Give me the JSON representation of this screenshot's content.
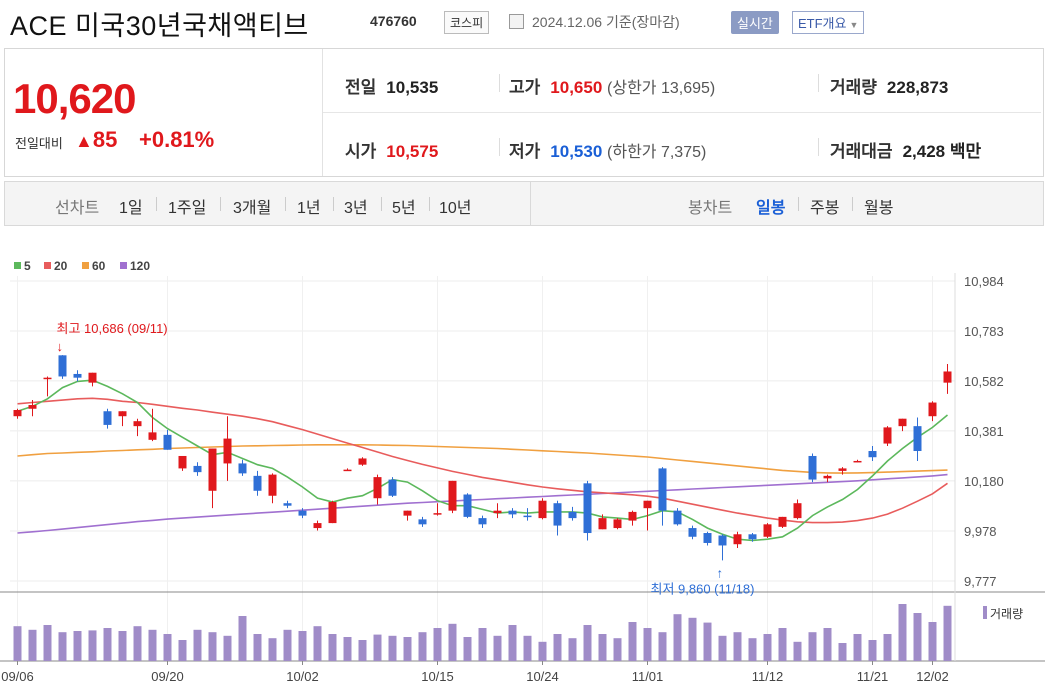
{
  "header": {
    "name": "ACE 미국30년국채액티브",
    "code": "476760",
    "market": "코스피",
    "date": "2024.12.06 기준(장마감)",
    "realtime": "실시간",
    "etf": "ETF개요"
  },
  "price": {
    "current": "10,620",
    "compare_label": "전일대비",
    "change": "85",
    "change_pct": "+0.81%",
    "prev_label": "전일",
    "prev": "10,535",
    "open_label": "시가",
    "open": "10,575",
    "high_label": "고가",
    "high": "10,650",
    "upper_limit_text": "(상한가 13,695)",
    "low_label": "저가",
    "low": "10,530",
    "lower_limit_text": "(하한가 7,375)",
    "volume_label": "거래량",
    "volume": "228,873",
    "amount_label": "거래대금",
    "amount": "2,428",
    "amount_unit": "백만"
  },
  "period_bar": {
    "line_chart": "선차트",
    "periods": [
      "1일",
      "1주일",
      "3개월",
      "1년",
      "3년",
      "5년",
      "10년"
    ],
    "candle_chart": "봉차트",
    "candle_periods": [
      "일봉",
      "주봉",
      "월봉"
    ],
    "selected_candle": "일봉"
  },
  "colors": {
    "up": "#e0181c",
    "down": "#2f6fd6",
    "ma5": "#5cb85c",
    "ma20": "#e85c5c",
    "ma60": "#f0a040",
    "ma120": "#a070d0",
    "volume": "#a08cc8"
  },
  "chart_data": {
    "type": "candlestick",
    "legend": [
      "5",
      "20",
      "60",
      "120"
    ],
    "y_ticks": [
      "10,984",
      "10,783",
      "10,582",
      "10,381",
      "10,180",
      "9,978",
      "9,777"
    ],
    "ylim": [
      9777,
      10984
    ],
    "x_labels": [
      "09/06",
      "09/20",
      "10/02",
      "10/15",
      "10/24",
      "11/01",
      "11/12",
      "11/21",
      "12/02"
    ],
    "annotation_high": "최고 10,686 (09/11)",
    "annotation_low": "최저 9,860 (11/18)",
    "volume_label": "거래량",
    "candles": [
      {
        "o": 10440,
        "h": 10470,
        "l": 10430,
        "c": 10465
      },
      {
        "o": 10470,
        "h": 10505,
        "l": 10440,
        "c": 10485
      },
      {
        "o": 10590,
        "h": 10600,
        "l": 10520,
        "c": 10595
      },
      {
        "o": 10685,
        "h": 10686,
        "l": 10590,
        "c": 10600
      },
      {
        "o": 10610,
        "h": 10625,
        "l": 10580,
        "c": 10595
      },
      {
        "o": 10575,
        "h": 10615,
        "l": 10560,
        "c": 10615
      },
      {
        "o": 10460,
        "h": 10470,
        "l": 10390,
        "c": 10405
      },
      {
        "o": 10440,
        "h": 10460,
        "l": 10400,
        "c": 10460
      },
      {
        "o": 10400,
        "h": 10430,
        "l": 10360,
        "c": 10420
      },
      {
        "o": 10345,
        "h": 10470,
        "l": 10340,
        "c": 10375
      },
      {
        "o": 10365,
        "h": 10385,
        "l": 10305,
        "c": 10305
      },
      {
        "o": 10230,
        "h": 10250,
        "l": 10220,
        "c": 10280
      },
      {
        "o": 10240,
        "h": 10255,
        "l": 10200,
        "c": 10215
      },
      {
        "o": 10140,
        "h": 10310,
        "l": 10070,
        "c": 10310
      },
      {
        "o": 10250,
        "h": 10440,
        "l": 10180,
        "c": 10350
      },
      {
        "o": 10250,
        "h": 10265,
        "l": 10200,
        "c": 10210
      },
      {
        "o": 10200,
        "h": 10220,
        "l": 10120,
        "c": 10140
      },
      {
        "o": 10120,
        "h": 10210,
        "l": 10090,
        "c": 10205
      },
      {
        "o": 10090,
        "h": 10100,
        "l": 10070,
        "c": 10080
      },
      {
        "o": 10060,
        "h": 10070,
        "l": 10030,
        "c": 10040
      },
      {
        "o": 9990,
        "h": 10020,
        "l": 9980,
        "c": 10010
      },
      {
        "o": 10010,
        "h": 10100,
        "l": 10010,
        "c": 10095
      },
      {
        "o": 10225,
        "h": 10230,
        "l": 10220,
        "c": 10225
      },
      {
        "o": 10245,
        "h": 10275,
        "l": 10240,
        "c": 10270
      },
      {
        "o": 10110,
        "h": 10205,
        "l": 10085,
        "c": 10195
      },
      {
        "o": 10185,
        "h": 10195,
        "l": 10115,
        "c": 10120
      },
      {
        "o": 10040,
        "h": 10060,
        "l": 10020,
        "c": 10060
      },
      {
        "o": 10025,
        "h": 10035,
        "l": 9995,
        "c": 10005
      },
      {
        "o": 10045,
        "h": 10090,
        "l": 10040,
        "c": 10050
      },
      {
        "o": 10060,
        "h": 10180,
        "l": 10050,
        "c": 10180
      },
      {
        "o": 10125,
        "h": 10130,
        "l": 10030,
        "c": 10035
      },
      {
        "o": 10030,
        "h": 10040,
        "l": 9990,
        "c": 10005
      },
      {
        "o": 10050,
        "h": 10090,
        "l": 10030,
        "c": 10060
      },
      {
        "o": 10060,
        "h": 10070,
        "l": 10030,
        "c": 10045
      },
      {
        "o": 10040,
        "h": 10070,
        "l": 10020,
        "c": 10035
      },
      {
        "o": 10030,
        "h": 10110,
        "l": 10025,
        "c": 10100
      },
      {
        "o": 10090,
        "h": 10100,
        "l": 9960,
        "c": 10000
      },
      {
        "o": 10055,
        "h": 10075,
        "l": 10020,
        "c": 10030
      },
      {
        "o": 10170,
        "h": 10180,
        "l": 9940,
        "c": 9970
      },
      {
        "o": 9985,
        "h": 10045,
        "l": 9985,
        "c": 10030
      },
      {
        "o": 9990,
        "h": 10030,
        "l": 9985,
        "c": 10025
      },
      {
        "o": 10020,
        "h": 10060,
        "l": 10000,
        "c": 10055
      },
      {
        "o": 10070,
        "h": 10100,
        "l": 9980,
        "c": 10100
      },
      {
        "o": 10230,
        "h": 10235,
        "l": 10000,
        "c": 10060
      },
      {
        "o": 10060,
        "h": 10070,
        "l": 10000,
        "c": 10005
      },
      {
        "o": 9990,
        "h": 10000,
        "l": 9945,
        "c": 9955
      },
      {
        "o": 9970,
        "h": 9975,
        "l": 9920,
        "c": 9930
      },
      {
        "o": 9960,
        "h": 9965,
        "l": 9860,
        "c": 9920
      },
      {
        "o": 9925,
        "h": 9975,
        "l": 9910,
        "c": 9965
      },
      {
        "o": 9965,
        "h": 9970,
        "l": 9935,
        "c": 9945
      },
      {
        "o": 9955,
        "h": 10010,
        "l": 9950,
        "c": 10005
      },
      {
        "o": 9995,
        "h": 10035,
        "l": 9990,
        "c": 10035
      },
      {
        "o": 10030,
        "h": 10105,
        "l": 10025,
        "c": 10090
      },
      {
        "o": 10280,
        "h": 10290,
        "l": 10175,
        "c": 10185
      },
      {
        "o": 10190,
        "h": 10205,
        "l": 10175,
        "c": 10200
      },
      {
        "o": 10220,
        "h": 10235,
        "l": 10205,
        "c": 10230
      },
      {
        "o": 10260,
        "h": 10265,
        "l": 10255,
        "c": 10260
      },
      {
        "o": 10300,
        "h": 10320,
        "l": 10260,
        "c": 10275
      },
      {
        "o": 10330,
        "h": 10400,
        "l": 10320,
        "c": 10395
      },
      {
        "o": 10400,
        "h": 10430,
        "l": 10380,
        "c": 10430
      },
      {
        "o": 10400,
        "h": 10435,
        "l": 10260,
        "c": 10300
      },
      {
        "o": 10440,
        "h": 10500,
        "l": 10420,
        "c": 10495
      },
      {
        "o": 10575,
        "h": 10650,
        "l": 10530,
        "c": 10620
      }
    ],
    "ma5": [
      10460,
      10480,
      10510,
      10555,
      10580,
      10585,
      10560,
      10530,
      10495,
      10435,
      10390,
      10355,
      10320,
      10285,
      10295,
      10270,
      10245,
      10230,
      10195,
      10155,
      10110,
      10095,
      10110,
      10120,
      10150,
      10185,
      10175,
      10140,
      10100,
      10080,
      10080,
      10065,
      10050,
      10055,
      10050,
      10055,
      10055,
      10055,
      10050,
      10035,
      10030,
      10025,
      10040,
      10060,
      10055,
      10025,
      9990,
      9965,
      9945,
      9940,
      9945,
      9955,
      9990,
      10040,
      10075,
      10105,
      10145,
      10200,
      10260,
      10310,
      10355,
      10395,
      10445
    ],
    "ma20": [
      10490,
      10495,
      10500,
      10505,
      10510,
      10512,
      10508,
      10500,
      10495,
      10488,
      10480,
      10472,
      10465,
      10456,
      10448,
      10440,
      10430,
      10418,
      10402,
      10386,
      10368,
      10350,
      10332,
      10314,
      10296,
      10278,
      10262,
      10246,
      10232,
      10218,
      10206,
      10194,
      10184,
      10174,
      10164,
      10155,
      10148,
      10142,
      10136,
      10132,
      10128,
      10124,
      10118,
      10110,
      10098,
      10086,
      10074,
      10062,
      10050,
      10040,
      10030,
      10022,
      10015,
      10012,
      10012,
      10014,
      10020,
      10030,
      10046,
      10070,
      10098,
      10128,
      10170
    ],
    "ma60": [
      10280,
      10285,
      10290,
      10292,
      10295,
      10297,
      10300,
      10302,
      10305,
      10307,
      10310,
      10312,
      10314,
      10316,
      10318,
      10320,
      10321,
      10322,
      10323,
      10324,
      10325,
      10325,
      10325,
      10325,
      10324,
      10323,
      10322,
      10320,
      10318,
      10316,
      10314,
      10312,
      10310,
      10307,
      10304,
      10301,
      10298,
      10295,
      10292,
      10288,
      10284,
      10280,
      10276,
      10270,
      10264,
      10258,
      10252,
      10246,
      10240,
      10234,
      10228,
      10222,
      10218,
      10214,
      10212,
      10211,
      10212,
      10213,
      10215,
      10217,
      10219,
      10221,
      10223
    ],
    "ma120": [
      9970,
      9975,
      9980,
      9986,
      9992,
      9998,
      10004,
      10010,
      10016,
      10021,
      10026,
      10030,
      10034,
      10038,
      10042,
      10046,
      10050,
      10054,
      10058,
      10062,
      10066,
      10070,
      10074,
      10078,
      10082,
      10086,
      10090,
      10093,
      10096,
      10099,
      10102,
      10105,
      10108,
      10111,
      10114,
      10117,
      10120,
      10123,
      10126,
      10129,
      10132,
      10135,
      10138,
      10141,
      10144,
      10147,
      10150,
      10153,
      10156,
      10159,
      10162,
      10165,
      10168,
      10171,
      10174,
      10177,
      10180,
      10184,
      10188,
      10192,
      10196,
      10200,
      10205
    ],
    "volume": [
      58,
      52,
      60,
      48,
      50,
      51,
      55,
      50,
      58,
      52,
      45,
      35,
      52,
      48,
      42,
      75,
      45,
      38,
      52,
      50,
      58,
      45,
      40,
      35,
      44,
      42,
      40,
      48,
      55,
      62,
      40,
      55,
      42,
      60,
      42,
      32,
      45,
      38,
      60,
      45,
      38,
      65,
      55,
      48,
      78,
      72,
      64,
      42,
      48,
      38,
      45,
      55,
      32,
      48,
      55,
      30,
      45,
      35,
      45,
      95,
      80,
      65,
      92
    ]
  }
}
